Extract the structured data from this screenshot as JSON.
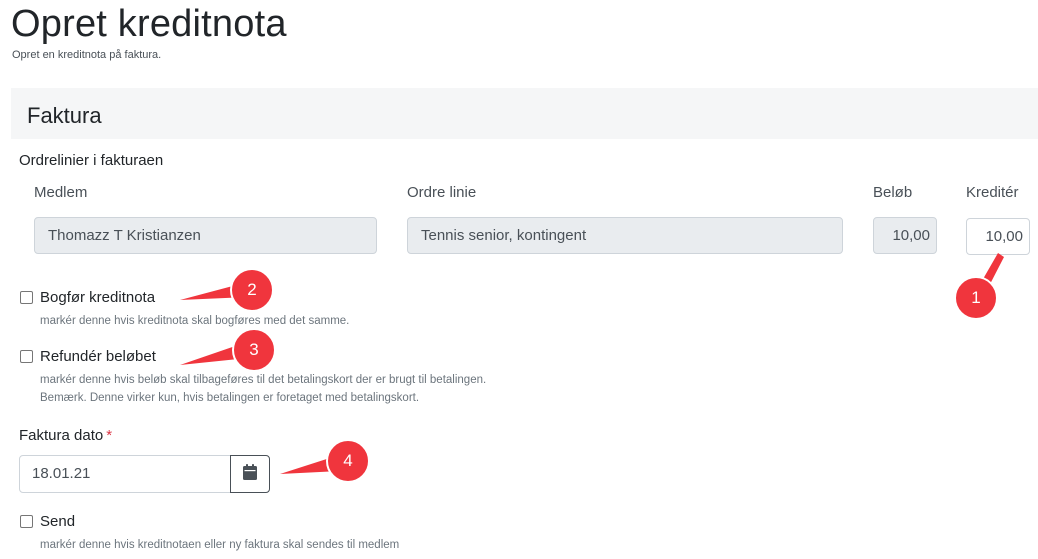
{
  "page": {
    "title": "Opret kreditnota",
    "subtitle": "Opret en kreditnota på faktura."
  },
  "section": {
    "title": "Faktura",
    "lines_heading": "Ordrelinier i fakturaen"
  },
  "columns": {
    "member": "Medlem",
    "order_line": "Ordre linie",
    "amount": "Beløb",
    "credit": "Kreditér"
  },
  "row": {
    "member": "Thomazz T Kristianzen",
    "order_line": "Tennis senior, kontingent",
    "amount": "10,00",
    "credit": "10,00"
  },
  "options": {
    "post": {
      "label": "Bogfør kreditnota",
      "help": "markér denne hvis kreditnota skal bogføres med det samme.",
      "checked": false
    },
    "refund": {
      "label": "Refundér beløbet",
      "help1": "markér denne hvis beløb skal tilbageføres til det betalingskort der er brugt til betalingen.",
      "help2": "Bemærk. Denne virker kun, hvis betalingen er foretaget med betalingskort.",
      "checked": false
    },
    "send": {
      "label": "Send",
      "help": "markér denne hvis kreditnotaen eller ny faktura skal sendes til medlem",
      "checked": false
    }
  },
  "date": {
    "label": "Faktura dato",
    "required_mark": "*",
    "value": "18.01.21",
    "button_icon": "calendar-icon"
  },
  "callouts": {
    "c1": "1",
    "c2": "2",
    "c3": "3",
    "c4": "4",
    "color": "#f0353d"
  }
}
